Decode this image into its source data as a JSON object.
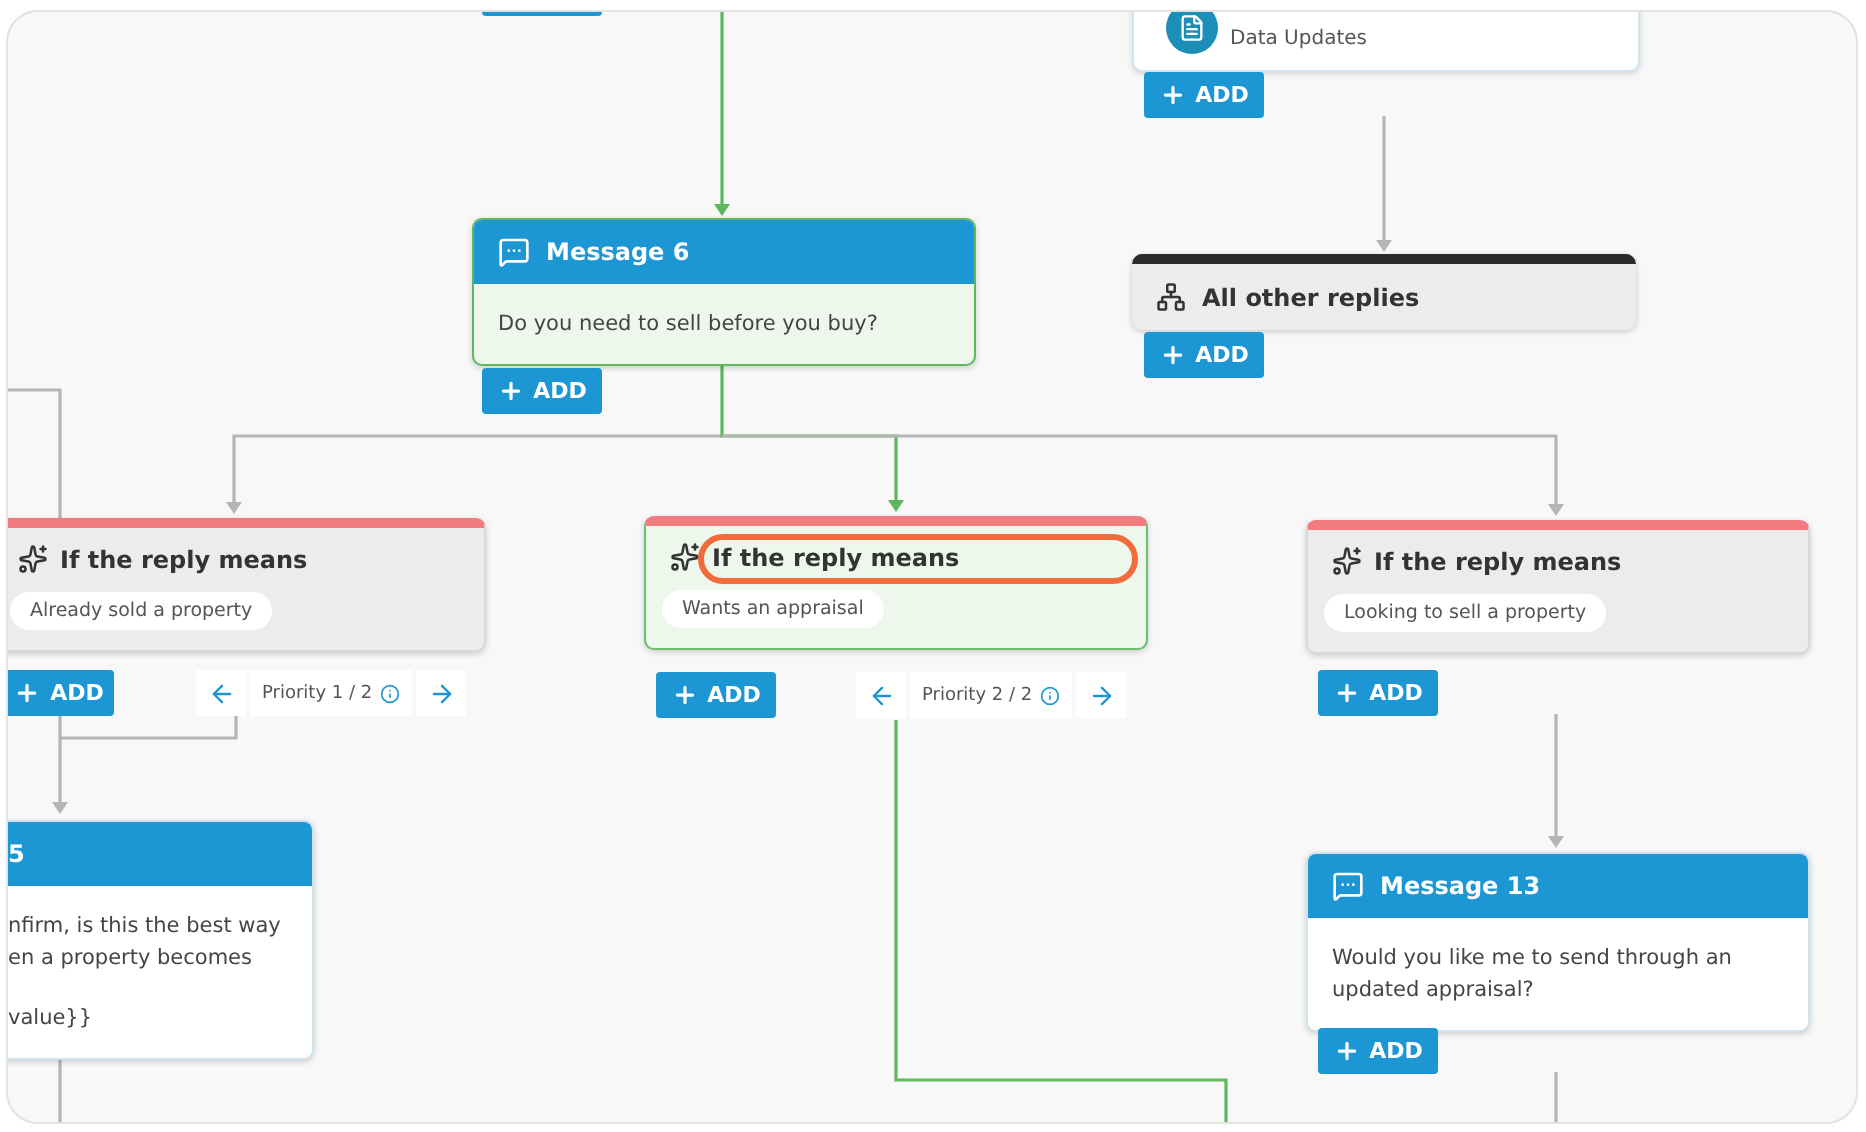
{
  "canvas": {
    "data_card": {
      "label": "Data Updates",
      "add": "ADD"
    },
    "fallback": {
      "title": "All other replies",
      "add": "ADD"
    },
    "messages": [
      {
        "title": "Message 6",
        "paragraphs": [
          [
            "Do you need to sell before you buy?"
          ]
        ],
        "selected": true,
        "add": "ADD"
      },
      {
        "title": "5",
        "paragraphs": [
          [
            "nfirm, is this the best way",
            "en a property becomes"
          ],
          [
            "value}}"
          ]
        ],
        "selected": false
      },
      {
        "title": "Message 13",
        "paragraphs": [
          [
            "Would you like me to send through an",
            "updated appraisal?"
          ]
        ],
        "selected": false,
        "add": "ADD"
      }
    ],
    "conditions": [
      {
        "title": "If the reply means",
        "intent": "Already sold a property",
        "selected": false,
        "annotated": false,
        "add": "ADD",
        "priority": "Priority 1 / 2"
      },
      {
        "title": "If the reply means",
        "intent": "Wants an appraisal",
        "selected": true,
        "annotated": true,
        "add": "ADD",
        "priority": "Priority 2 / 2"
      },
      {
        "title": "If the reply means",
        "intent": "Looking to sell a property",
        "selected": false,
        "annotated": false,
        "add": "ADD"
      }
    ]
  }
}
